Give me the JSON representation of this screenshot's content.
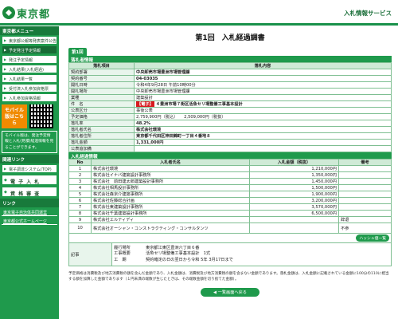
{
  "header": {
    "logo": "東京都",
    "service": "入札情報サービス"
  },
  "sidebar": {
    "menu_heading": "東京都メニュー",
    "items": [
      "東京都公報等発表案件公告",
      "予定発注予定情報",
      "発注予定情報",
      "入札結果(入札経過)",
      "入札結果一覧",
      "受付済入札参加資格票",
      "入札参加資格情報"
    ],
    "mobile_label": "モバイル版はこちら",
    "mobile_note": "モバイル版は、発注予定情報と入札(見積)経過情報を見ることができます。",
    "link_heading": "関連リンク",
    "system_button": "電子調達システム(TOP)",
    "big_buttons": [
      "電 子 入 札",
      "資 格 審 査"
    ],
    "footer_heading": "リンク",
    "footer_links": [
      "東京電子自治体共同運営",
      "東京都公式ホームページ"
    ]
  },
  "main": {
    "title": "第1回　入札経過調書",
    "round_tab": "第1回",
    "info_section": "落札者情報",
    "info_headers": [
      "落札項目",
      "落札内容"
    ],
    "info_rows": [
      {
        "k": "契約部署",
        "v": "中央卸売市場豊洲市場管理課",
        "bold": true
      },
      {
        "k": "契約番号",
        "v": "04-03035",
        "bold": true
      },
      {
        "k": "開札日時",
        "v": "令和4年9月28日 午前10時00分"
      },
      {
        "k": "開札場所",
        "v": "中央卸売市場豊洲市場管理課"
      },
      {
        "k": "業種",
        "v": "建築設計"
      },
      {
        "k": "件　名",
        "tag": "【電子】",
        "v": "４豊洲市場７街区活魚セリ場整備工事基本設計",
        "bold": true
      },
      {
        "k": "公表区分",
        "v": "事後公表"
      },
      {
        "k": "予定価格",
        "v": "2,759,900円（税込）　　2,509,000円（税抜）"
      },
      {
        "k": "落札率",
        "v": "48.2%",
        "bold": true
      },
      {
        "k": "落札者氏名",
        "v": "株式会社環境",
        "bold": true
      },
      {
        "k": "落札者住所",
        "v": "東京都千代田区神田錦町一丁目４番地８",
        "bold": true
      },
      {
        "k": "落札金額",
        "v": "1,331,000円",
        "bold": true
      },
      {
        "k": "公表追加備",
        "v": ""
      }
    ],
    "bid_section": "入札経過情報",
    "bid_headers": [
      "No",
      "入札者氏名",
      "入札金額（税抜）",
      "備考"
    ],
    "bids": [
      {
        "no": "1",
        "name": "株式会社環境",
        "amount": "1,210,000円",
        "note": ""
      },
      {
        "no": "2",
        "name": "株式会社イナバ建築設計事務所",
        "amount": "1,350,000円",
        "note": ""
      },
      {
        "no": "3",
        "name": "株式会社　前田建太郎建築設計事務所",
        "amount": "1,450,000円",
        "note": ""
      },
      {
        "no": "4",
        "name": "株式会社相馬設計事務所",
        "amount": "1,500,000円",
        "note": ""
      },
      {
        "no": "5",
        "name": "株式会社森京介建築事務所",
        "amount": "1,900,000円",
        "note": ""
      },
      {
        "no": "6",
        "name": "株式会社佐藤総合計画",
        "amount": "3,200,000円",
        "note": ""
      },
      {
        "no": "7",
        "name": "株式会社東建築設計事務所",
        "amount": "3,570,000円",
        "note": ""
      },
      {
        "no": "8",
        "name": "株式会社千葉建築設計事務所",
        "amount": "6,500,000円",
        "note": ""
      },
      {
        "no": "9",
        "name": "株式会社エルティディ",
        "amount": "",
        "note": "辞退"
      },
      {
        "no": "10",
        "name": "株式会社オーシャン・コンストラクティング・コンサルタンツ",
        "amount": "",
        "note": "不参"
      }
    ],
    "toggle_label": "ハッシュ値一覧",
    "memo_label": "記事",
    "memo_lines": [
      [
        "履行場所",
        "東京都江東区豊洲六丁目６番"
      ],
      [
        "工事概要",
        "活魚セリ場整備工事基本設計　1式"
      ],
      [
        "工　期",
        "契約確定の日の翌日から令和 5年 3月17日まで"
      ]
    ],
    "footnote": "予定価格は消費税及び地方消費税の額を含んだ金額であり、入札金額は、消費税及び地方消費税の額を含まない金額であります。落札金額は、入札金額に記載されている金額に100分の110に相当する額を加算した金額であります（１円未満の端数が生じたときは、その端数金額を切り捨てた金額）。",
    "back_button": "◀ 一覧画面へ戻る"
  }
}
